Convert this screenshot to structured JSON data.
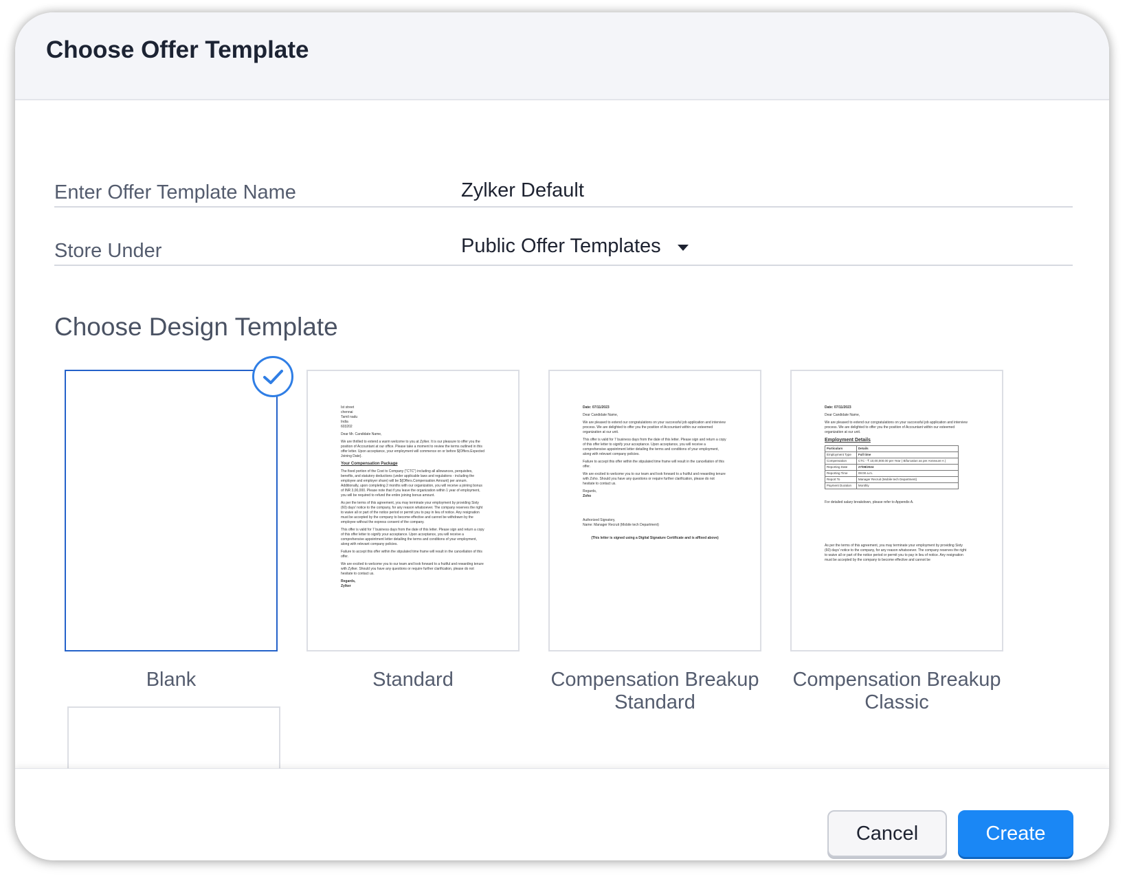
{
  "dialog": {
    "title": "Choose Offer Template"
  },
  "form": {
    "name_label": "Enter Offer Template Name",
    "name_value": "Zylker Default",
    "store_label": "Store Under",
    "store_value": "Public Offer Templates"
  },
  "design": {
    "section_title": "Choose Design Template",
    "templates": [
      {
        "label": "Blank",
        "selected": true
      },
      {
        "label": "Standard",
        "selected": false
      },
      {
        "label": "Compensation Breakup Standard",
        "selected": false
      },
      {
        "label": "Compensation Breakup Classic",
        "selected": false
      }
    ]
  },
  "previews": {
    "standard": {
      "address": [
        "Ist street",
        "chennai",
        "Tamil nadu",
        "India",
        "603202"
      ],
      "greeting": "Dear Mr. Candidate Name,",
      "p1": "We are thrilled to extend a warm welcome to you at Zylker. It is our pleasure to offer you the position of Accountant at our office. Please take a moment to review the terms outlined in this offer letter. Upon acceptance, your employment will commence on or before ${Offers.Expected Joining Date}.",
      "heading": "Your Compensation Package",
      "p2": "The fixed portion of the Cost to Company (\"CTC\") including all allowances, perquisites, benefits, and statutory deductions (under applicable laws and regulations - including the employee and employer share) will be ${Offers.Compensation Amount} per annum. Additionally, upon completing 2 months with our organization, you will receive a joining bonus of INR 3,00,000. Please note that if you leave the organization within 1 year of employment, you will be required to refund the entire joining bonus amount.",
      "p3": "As per the terms of this agreement, you may terminate your employment by providing Sixty (60) days' notice to the company, for any reason whatsoever. The company reserves the right to waive all or part of the notice period or permit you to pay in lieu of notice. Any resignation must be accepted by the company to become effective and cannot be withdrawn by the employee without the express consent of the company.",
      "p4": "This offer is valid for 7 business days from the date of this letter. Please sign and return a copy of this offer letter to signify your acceptance. Upon acceptance, you will receive a comprehensive appointment letter detailing the terms and conditions of your employment, along with relevant company policies.",
      "p5": "Failure to accept this offer within the stipulated time frame will result in the cancellation of this offer.",
      "p6": "We are excited to welcome you to our team and look forward to a fruitful and rewarding tenure with Zylker. Should you have any questions or require further clarification, please do not hesitate to contact us.",
      "regards": "Regards,",
      "company": "Zylker"
    },
    "comp_standard": {
      "date": "Date: 07/11/2023",
      "greeting": "Dear Candidate Name,",
      "p1": "We are pleased to extend our congratulations on your successful job application and interview process. We are delighted to offer you the position of Accountant within our esteemed organization at our unit.",
      "p2": "This offer is valid for 7 business days from the date of this letter. Please sign and return a copy of this offer letter to signify your acceptance. Upon acceptance, you will receive a comprehensive appointment letter detailing the terms and conditions of your employment, along with relevant company policies.",
      "p3": "Failure to accept this offer within the stipulated time frame will result in the cancellation of this offer.",
      "p4": "We are excited to welcome you to our team and look forward to a fruitful and rewarding tenure with Zoho. Should you have any questions or require further clarification, please do not hesitate to contact us.",
      "regards": "Regards,",
      "company": "Zoho",
      "signatory": "Authorized Signatory,",
      "signatory_name": "Name: Manager Recruit (Mobile tech Department)",
      "note": "(This letter is signed using a Digital Signature Certificate and is affixed above)"
    },
    "comp_classic": {
      "date": "Date: 07/11/2023",
      "greeting": "Dear Candidate Name,",
      "p1": "We are pleased to extend our congratulations on your successful job application and interview process. We are delighted to offer you the position of Accountant within our esteemed organization at our unit.",
      "heading": "Employment Details",
      "table_header": [
        "Particulars",
        "Details"
      ],
      "rows": [
        [
          "Employment Type",
          "Full time"
        ],
        [
          "Compensation",
          "CTC - ₹ 10,00,000.00 per Year ( Bifurcation as per Annexure A )"
        ],
        [
          "Reporting Date",
          "27/08/2024"
        ],
        [
          "Reporting Time",
          "09:00 a.m."
        ],
        [
          "Report To",
          "Manager Recruit (Mobile tech Department)"
        ],
        [
          "Payment Duration",
          "Monthly"
        ]
      ],
      "p2": "For detailed salary breakdown, please refer to Appendix A.",
      "p3": "As per the terms of this agreement, you may terminate your employment by providing Sixty (60) days' notice to the company, for any reason whatsoever. The company reserves the right to waive all or part of the notice period or permit you to pay in lieu of notice. Any resignation must be accepted by the company to become effective and cannot be"
    }
  },
  "footer": {
    "cancel_label": "Cancel",
    "create_label": "Create"
  },
  "colors": {
    "accent": "#1a87f5",
    "selected_border": "#2361c9",
    "header_bg": "#f4f5f9"
  }
}
